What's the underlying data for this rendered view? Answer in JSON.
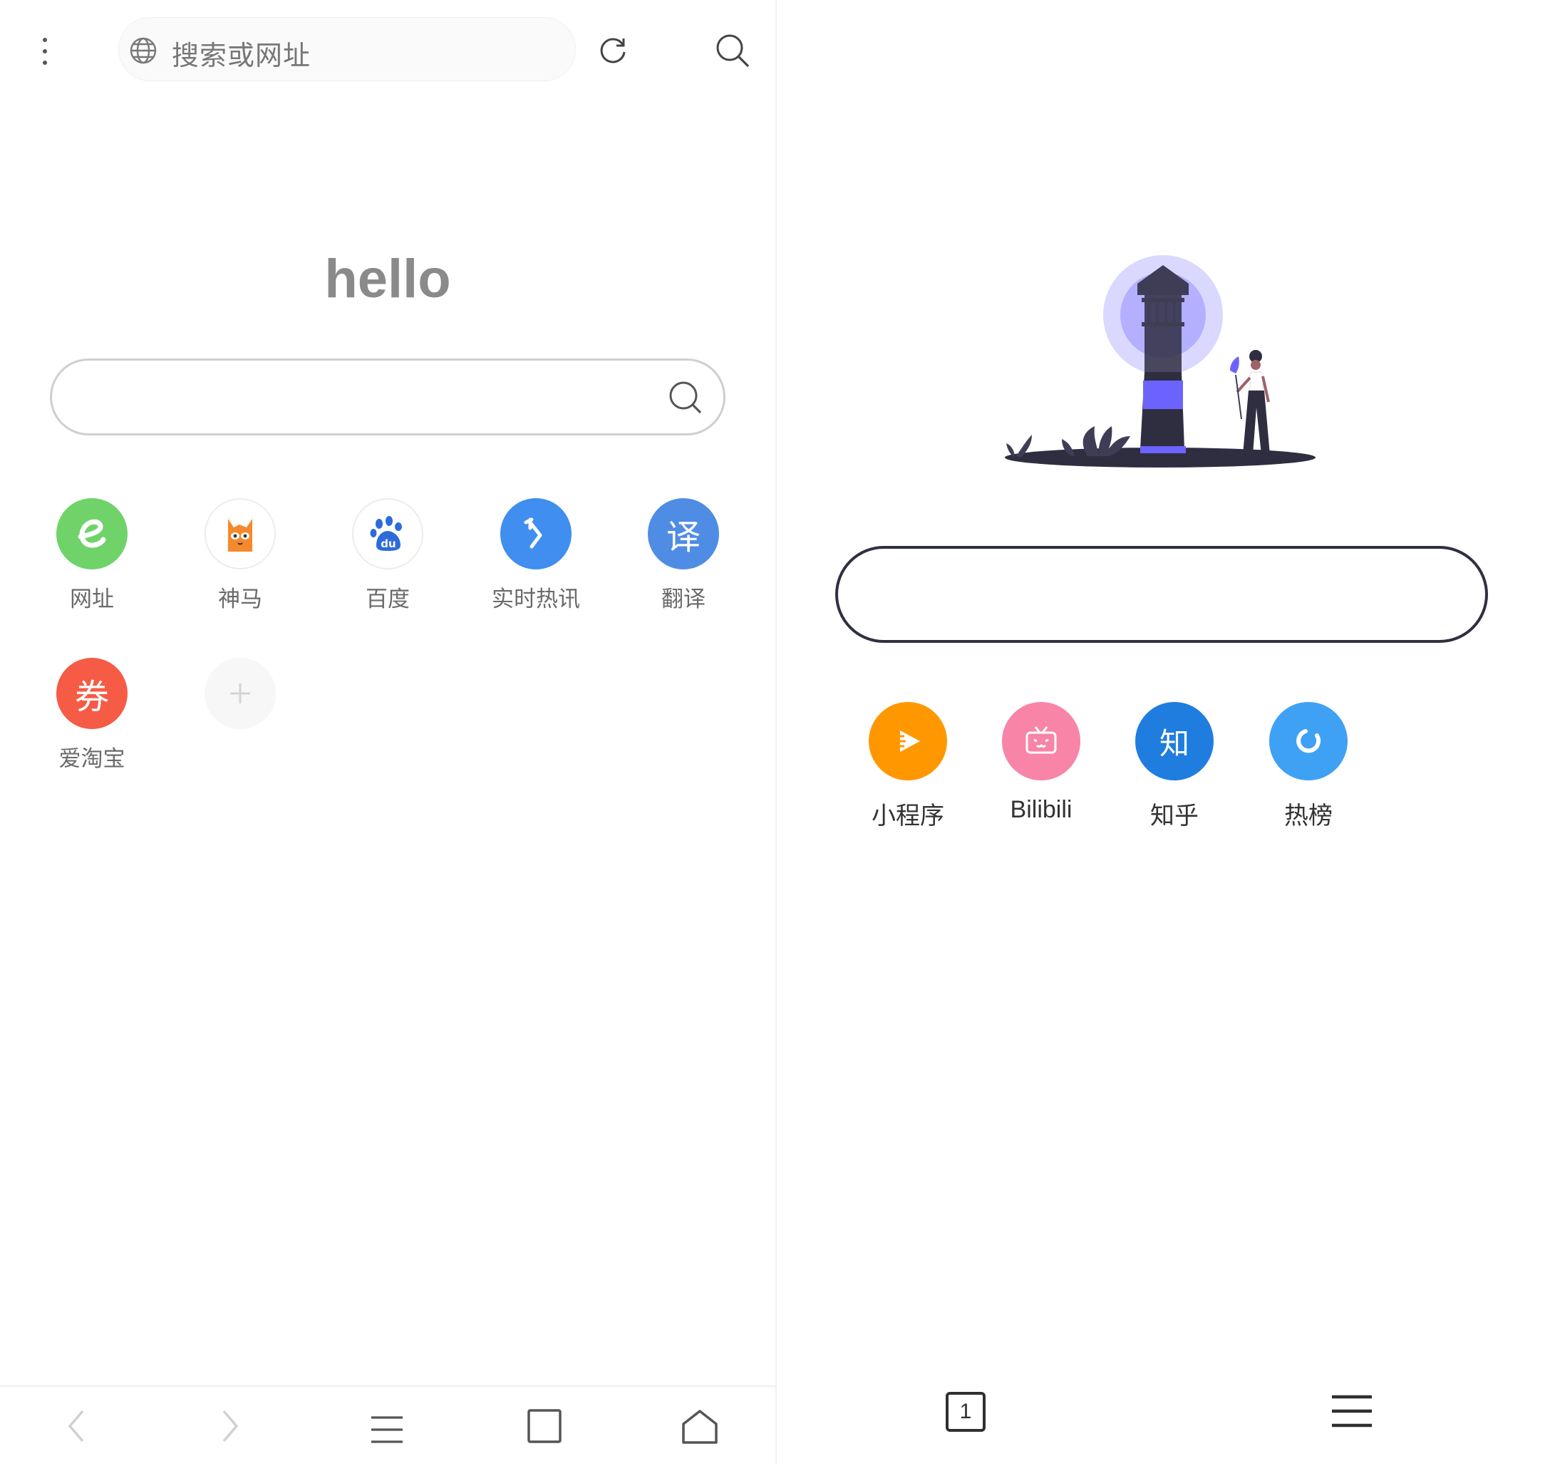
{
  "left": {
    "address_bar": {
      "placeholder": "搜索或网址"
    },
    "greeting": "hello",
    "shortcuts": [
      {
        "label": "网址",
        "icon": "e-icon",
        "color": "#6fd36a"
      },
      {
        "label": "神马",
        "icon": "alpaca-icon",
        "color": "#ffffff"
      },
      {
        "label": "百度",
        "icon": "baidu-paw-icon",
        "color": "#ffffff"
      },
      {
        "label": "实时热讯",
        "icon": "pointer-icon",
        "color": "#3f8ef0"
      },
      {
        "label": "翻译",
        "icon": "translate-icon",
        "glyph": "译",
        "color": "#4f8de4"
      },
      {
        "label": "爱淘宝",
        "icon": "coupon-icon",
        "glyph": "券",
        "color": "#f55b45"
      },
      {
        "label": "",
        "icon": "plus-icon",
        "color": "#f7f7f7"
      }
    ],
    "bottom_nav": [
      "back",
      "forward",
      "menu",
      "tabs",
      "home"
    ]
  },
  "right": {
    "shortcuts": [
      {
        "label": "小程序",
        "icon": "play-icon",
        "color": "#ff9800"
      },
      {
        "label": "Bilibili",
        "icon": "tv-icon",
        "color": "#f884a8"
      },
      {
        "label": "知乎",
        "icon": "zhihu-icon",
        "glyph": "知",
        "color": "#1f7ddf"
      },
      {
        "label": "热榜",
        "icon": "loading-ring-icon",
        "color": "#3fa1f4"
      }
    ],
    "tab_count": "1"
  },
  "colors": {
    "accent_purple": "#6c63ff",
    "dark": "#2f2e41"
  }
}
